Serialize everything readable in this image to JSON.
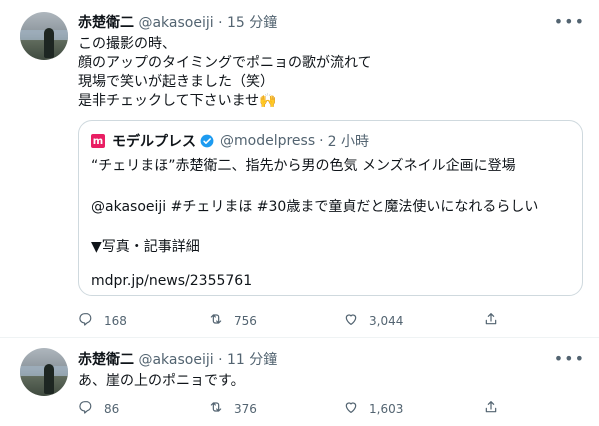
{
  "tweets": [
    {
      "author_name": "赤楚衛二",
      "handle": "@akasoeiji",
      "separator": "·",
      "time": "15 分鐘",
      "more": "•••",
      "lines": [
        "この撮影の時、",
        "顔のアップのタイミングでポニョの歌が流れて",
        "現場で笑いが起きました（笑）",
        "是非チェックして下さいませ🙌"
      ],
      "quote": {
        "logo_text": "m",
        "author_name": "モデルプレス",
        "handle": "@modelpress",
        "separator": "·",
        "time": "2 小時",
        "line1": "“チェリまほ”赤楚衛二、指先から男の色気 メンズネイル企画に登場",
        "line2": "@akasoeiji #チェリまほ #30歳まで童貞だと魔法使いになれるらしい",
        "line3": "▼写真・記事詳細",
        "line4": "mdpr.jp/news/2355761"
      },
      "replies": "168",
      "retweets": "756",
      "likes": "3,044"
    },
    {
      "author_name": "赤楚衛二",
      "handle": "@akasoeiji",
      "separator": "·",
      "time": "11 分鐘",
      "more": "•••",
      "lines": [
        "あ、崖の上のポニョです。"
      ],
      "replies": "86",
      "retweets": "376",
      "likes": "1,603"
    }
  ],
  "colors": {
    "text": "#0f1419",
    "muted": "#536471",
    "border": "#cfd9de",
    "verified": "#1d9bf0",
    "brand": "#e91e63"
  },
  "icons": {
    "reply": "reply-icon",
    "retweet": "retweet-icon",
    "like": "heart-icon",
    "share": "share-icon",
    "verified": "verified-badge-icon"
  }
}
